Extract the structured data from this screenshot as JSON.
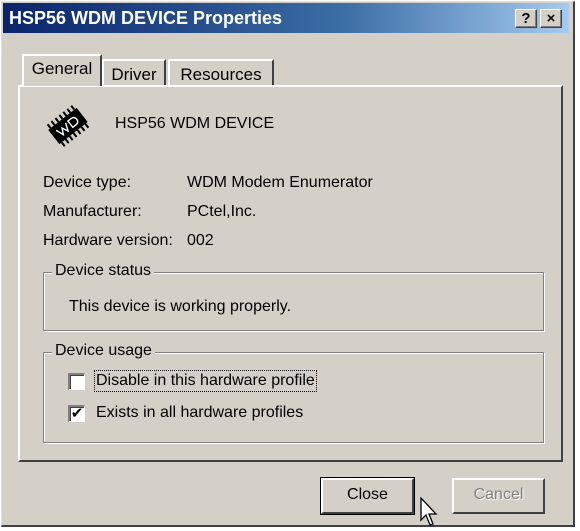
{
  "window": {
    "title": "HSP56 WDM DEVICE Properties",
    "help_label": "?",
    "close_label": "×"
  },
  "tabs": [
    {
      "label": "General",
      "selected": true
    },
    {
      "label": "Driver",
      "selected": false
    },
    {
      "label": "Resources",
      "selected": false
    }
  ],
  "device": {
    "name": "HSP56 WDM DEVICE",
    "icon": "chip-icon",
    "type_label": "Device type:",
    "type_value": "WDM Modem Enumerator",
    "manufacturer_label": "Manufacturer:",
    "manufacturer_value": "PCtel,Inc.",
    "hardware_version_label": "Hardware version:",
    "hardware_version_value": "002"
  },
  "status_group": {
    "title": "Device status",
    "text": "This device is working properly."
  },
  "usage_group": {
    "title": "Device usage",
    "options": [
      {
        "label": "Disable in this hardware profile",
        "checked": false
      },
      {
        "label": "Exists in all hardware profiles",
        "checked": true
      }
    ]
  },
  "buttons": {
    "close": "Close",
    "cancel": "Cancel"
  },
  "colors": {
    "title_bar_start": "#0a246a",
    "title_bar_end": "#a6caf0",
    "face": "#d4d0c8"
  }
}
